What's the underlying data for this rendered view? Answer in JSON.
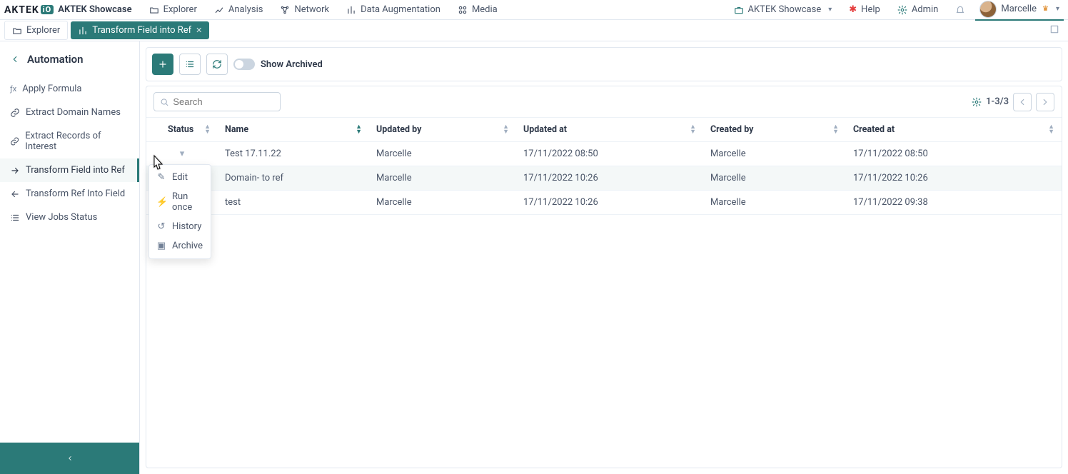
{
  "brand": {
    "mark": "AKTEK",
    "io": "iO",
    "workspace": "AKTEK Showcase"
  },
  "topnav": {
    "items": [
      {
        "label": "Explorer"
      },
      {
        "label": "Analysis"
      },
      {
        "label": "Network"
      },
      {
        "label": "Data Augmentation"
      },
      {
        "label": "Media"
      }
    ],
    "right": {
      "workspace": "AKTEK Showcase",
      "help": "Help",
      "admin": "Admin",
      "user": "Marcelle"
    }
  },
  "tabs": {
    "items": [
      {
        "label": "Explorer",
        "active": false
      },
      {
        "label": "Transform Field into Ref",
        "active": true
      }
    ]
  },
  "sidebar": {
    "header": "Automation",
    "items": [
      {
        "label": "Apply Formula"
      },
      {
        "label": "Extract Domain Names"
      },
      {
        "label": "Extract Records of Interest"
      },
      {
        "label": "Transform Field into Ref"
      },
      {
        "label": "Transform Ref Into Field"
      },
      {
        "label": "View Jobs Status"
      }
    ],
    "active_index": 3
  },
  "toolbar": {
    "show_archived_label": "Show Archived"
  },
  "search": {
    "placeholder": "Search"
  },
  "pager": {
    "range": "1-3/3"
  },
  "columns": {
    "status": "Status",
    "name": "Name",
    "updated_by": "Updated by",
    "updated_at": "Updated at",
    "created_by": "Created by",
    "created_at": "Created at"
  },
  "rows": [
    {
      "name": "Test 17.11.22",
      "updated_by": "Marcelle",
      "updated_at": "17/11/2022 08:50",
      "created_by": "Marcelle",
      "created_at": "17/11/2022 08:50"
    },
    {
      "name": "Domain- to ref",
      "updated_by": "Marcelle",
      "updated_at": "17/11/2022 10:26",
      "created_by": "Marcelle",
      "created_at": "17/11/2022 10:26"
    },
    {
      "name": "test",
      "updated_by": "Marcelle",
      "updated_at": "17/11/2022 10:26",
      "created_by": "Marcelle",
      "created_at": "17/11/2022 09:38"
    }
  ],
  "context_menu": {
    "items": [
      {
        "label": "Edit"
      },
      {
        "label": "Run once"
      },
      {
        "label": "History"
      },
      {
        "label": "Archive"
      }
    ]
  }
}
